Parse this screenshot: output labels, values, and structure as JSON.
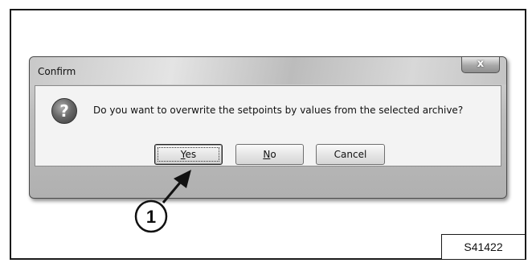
{
  "dialog": {
    "title": "Confirm",
    "close_label": "x",
    "message": "Do you want to overwrite the setpoints by values from the selected archive?",
    "icon": "question-icon"
  },
  "buttons": {
    "yes": {
      "accel": "Y",
      "rest": "es"
    },
    "no": {
      "accel": "N",
      "rest": "o"
    },
    "cancel": "Cancel"
  },
  "callout": {
    "number": "1",
    "target": "yes-button"
  },
  "figure_code": "S41422"
}
